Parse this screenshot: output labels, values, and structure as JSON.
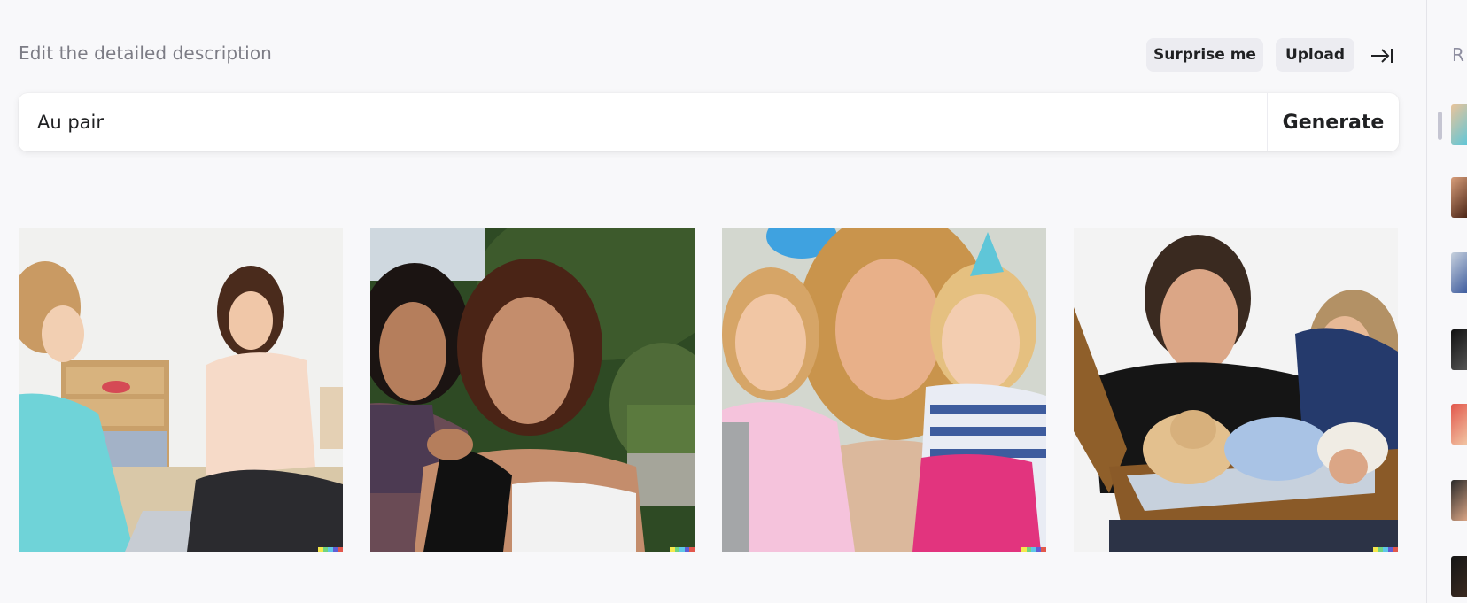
{
  "header": {
    "label": "Edit the detailed description",
    "surprise_label": "Surprise me",
    "upload_label": "Upload"
  },
  "prompt": {
    "value": "Au pair",
    "generate_label": "Generate"
  },
  "results": [
    {
      "name": "Girl and woman sitting on floor with clothes"
    },
    {
      "name": "Two women outdoors"
    },
    {
      "name": "Woman with two little girls at party"
    },
    {
      "name": "Man and woman with puppy in suitcase"
    }
  ],
  "sidebar": {
    "label": "R"
  },
  "colors": {
    "background": "#f8f8fa",
    "pill": "#ececf1",
    "text": "#202123",
    "muted": "#7c7c85"
  }
}
